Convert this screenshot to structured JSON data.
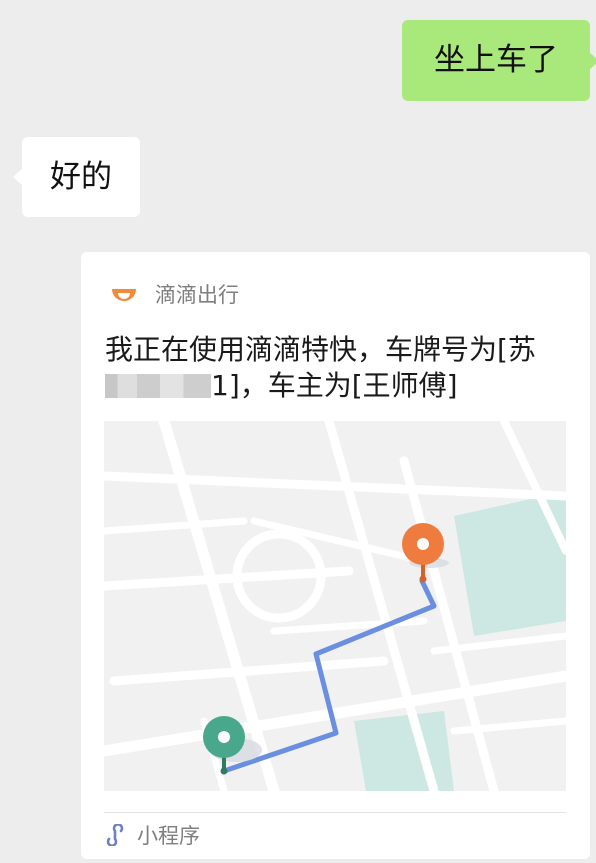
{
  "messages": {
    "outgoing_text": "坐上车了",
    "incoming_text": "好的"
  },
  "card": {
    "app_icon": "didi-logo-icon",
    "app_name": "滴滴出行",
    "text_part1": "我正在使用滴滴特快，车牌号为[苏",
    "text_part2": "1]，车主为[王师傅]",
    "map": {
      "route_color": "#6b8fe0",
      "origin_pin_color": "#49a88c",
      "destination_pin_color": "#f07b3f",
      "park_color": "#cde8e2"
    },
    "footer_icon": "mini-program-icon",
    "footer_label": "小程序"
  },
  "colors": {
    "background": "#ededed",
    "outgoing_bubble": "#a9e87a",
    "incoming_bubble": "#ffffff",
    "brand_orange": "#f28a3c"
  }
}
